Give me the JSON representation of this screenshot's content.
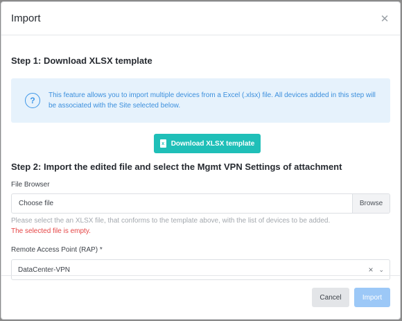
{
  "modal": {
    "title": "Import",
    "close_icon": "close-icon"
  },
  "step1": {
    "title": "Step 1: Download XLSX template",
    "info_icon": "question-circle-icon",
    "info_text": "This feature allows you to import multiple devices from a Excel (.xlsx) file. All devices added in this step will be associated with the Site selected below.",
    "download_label": "Download XLSX template",
    "download_icon": "xlsx-file-icon"
  },
  "step2": {
    "title": "Step 2: Import the edited file and select the Mgmt VPN Settings of attachment",
    "file_label": "File Browser",
    "file_placeholder": "Choose file",
    "browse_label": "Browse",
    "help_text": "Please select the an XLSX file, that conforms to the template above, with the list of devices to be added.",
    "error_text": "The selected file is empty.",
    "rap_label": "Remote Access Point (RAP) *",
    "rap_value": "DataCenter-VPN"
  },
  "footer": {
    "cancel_label": "Cancel",
    "import_label": "Import"
  },
  "colors": {
    "accent_teal": "#1fbfb8",
    "info_blue": "#3b8fdd",
    "error_red": "#e54545",
    "import_disabled": "#9cc8f7"
  }
}
